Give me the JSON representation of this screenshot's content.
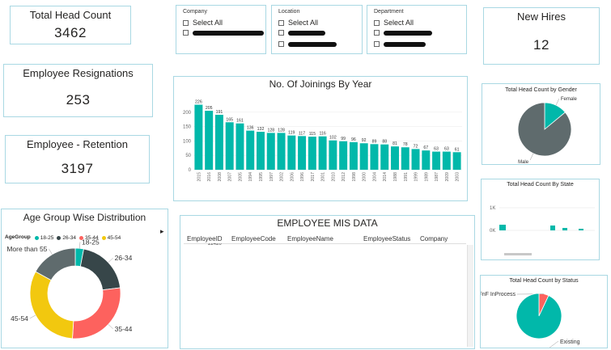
{
  "kpis": {
    "total_head_count": {
      "label": "Total Head Count",
      "value": "3462"
    },
    "new_hires": {
      "label": "New Hires",
      "value": "12"
    },
    "resignations": {
      "label": "Employee Resignations",
      "value": "253"
    },
    "retention": {
      "label": "Employee - Retention",
      "value": "3197"
    }
  },
  "slicers": {
    "company": {
      "title": "Company",
      "select_all": "Select All"
    },
    "location": {
      "title": "Location",
      "select_all": "Select All"
    },
    "department": {
      "title": "Department",
      "select_all": "Select All"
    }
  },
  "table": {
    "title": "EMPLOYEE MIS  DATA",
    "columns": [
      "EmployeeID",
      "EmployeeCode",
      "EmployeeName",
      "EmployeeStatus",
      "Company"
    ],
    "partial_cell": "22420"
  },
  "age_legend": {
    "title": "AgeGroup",
    "more_arrow": "▸"
  },
  "state_chart": {
    "tick_1k": "1K",
    "tick_0k": "0K"
  },
  "colors": {
    "teal": "#01b8aa",
    "dark": "#374649",
    "red": "#fd625e",
    "yellow": "#f2c80f",
    "gray": "#5f6b6d",
    "border": "#a9d8e3"
  },
  "chart_data": [
    {
      "type": "bar",
      "title": "No. Of Joinings By Year",
      "categories": [
        "2015",
        "2016",
        "2008",
        "2007",
        "2005",
        "1994",
        "1995",
        "1997",
        "2002",
        "2006",
        "1996",
        "2017",
        "2001",
        "2010",
        "2012",
        "1998",
        "2000",
        "2004",
        "2014",
        "1988",
        "1991",
        "1999",
        "1989",
        "1987",
        "2009",
        "2003"
      ],
      "values": [
        226,
        205,
        191,
        165,
        161,
        136,
        132,
        128,
        128,
        119,
        117,
        115,
        116,
        102,
        99,
        96,
        92,
        89,
        88,
        81,
        78,
        72,
        67,
        63,
        63,
        61
      ],
      "ylim": [
        0,
        250
      ],
      "yticks": [
        0,
        50,
        100,
        150,
        200
      ],
      "color": "#01b8aa"
    },
    {
      "type": "pie",
      "title": "Total Head Count by Gender",
      "labels": [
        "Female",
        "Male"
      ],
      "values": [
        14,
        86
      ],
      "colors": [
        "#01b8aa",
        "#5f6b6d"
      ]
    },
    {
      "type": "bar",
      "title": "Total Head Count By State",
      "yticks": [
        "0K",
        "1K"
      ]
    },
    {
      "type": "pie",
      "title": "Age Group Wise Distribution",
      "donut": true,
      "labels": [
        "18-25",
        "26-34",
        "35-44",
        "45-54",
        "More than 55"
      ],
      "values": [
        3,
        20,
        28,
        32,
        17
      ],
      "colors": [
        "#01b8aa",
        "#374649",
        "#fd625e",
        "#f2c80f",
        "#5f6b6d"
      ]
    },
    {
      "type": "pie",
      "title": "Total Head Count by Status",
      "labels": [
        "FnF InProcess",
        "Existing"
      ],
      "values": [
        7,
        93
      ],
      "colors": [
        "#fd625e",
        "#01b8aa"
      ]
    }
  ]
}
